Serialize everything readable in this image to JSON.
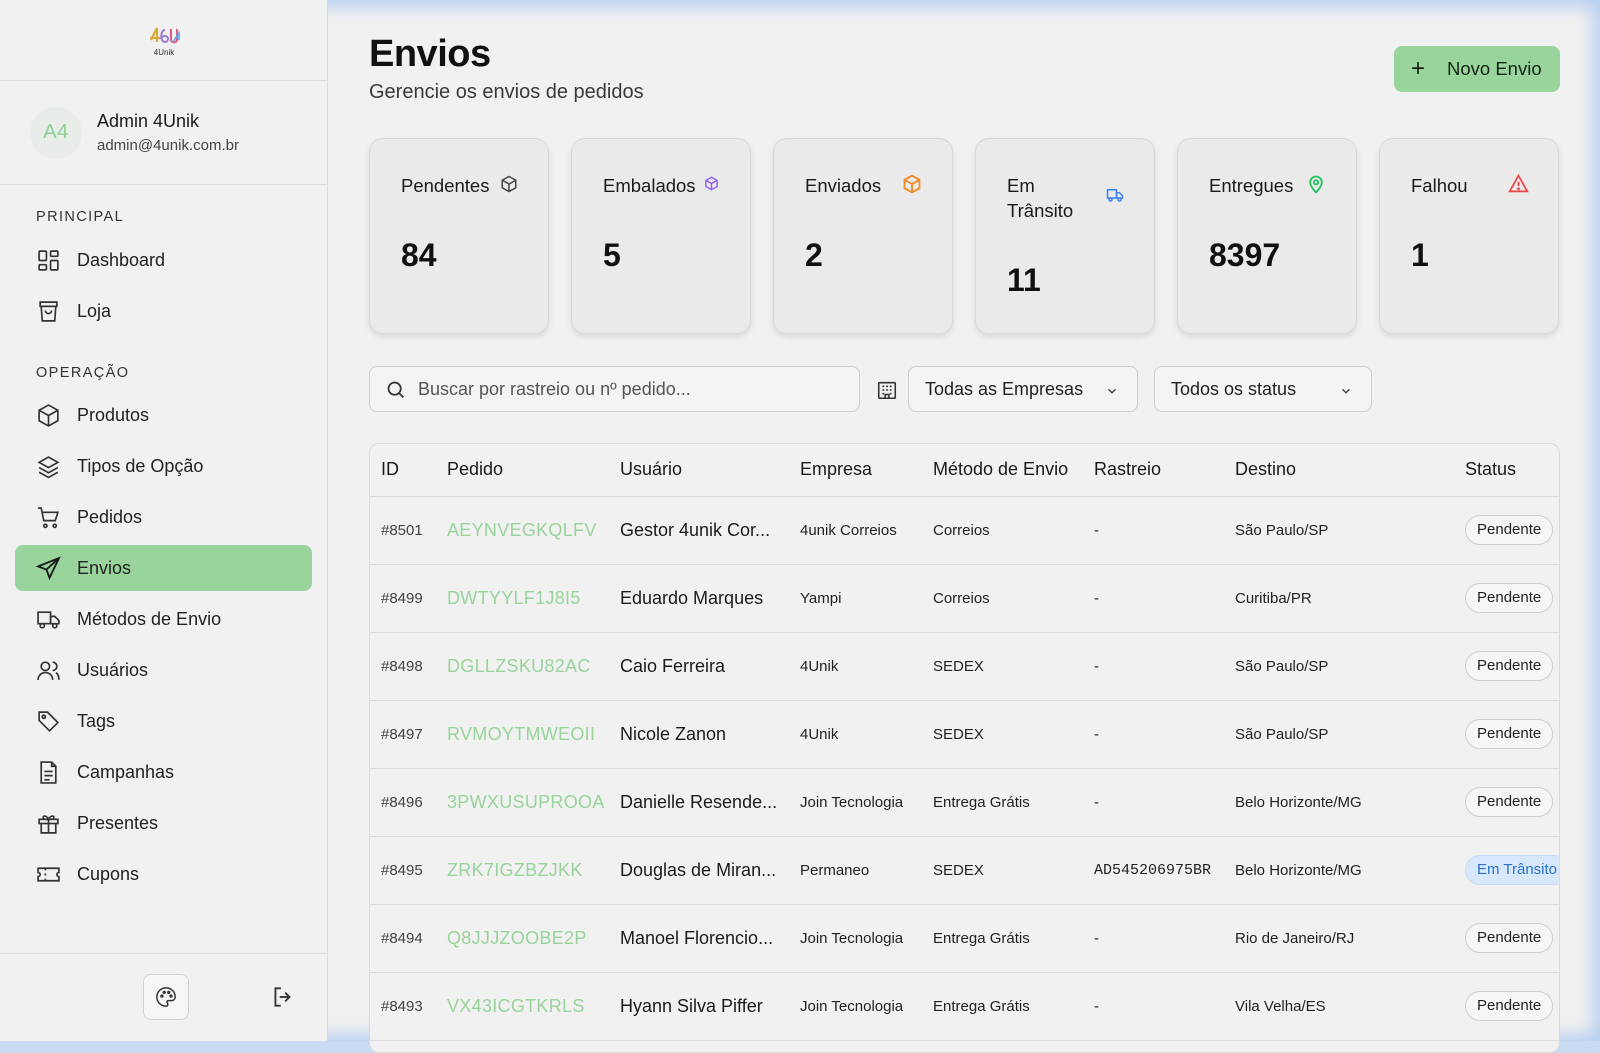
{
  "app": {
    "logo_text": "4Unik"
  },
  "user": {
    "initials": "A4",
    "name": "Admin 4Unik",
    "email": "admin@4unik.com.br"
  },
  "nav": {
    "sections": [
      {
        "title": "PRINCIPAL",
        "items": [
          {
            "label": "Dashboard",
            "icon": "dashboard-icon"
          },
          {
            "label": "Loja",
            "icon": "shopping-bag-icon"
          }
        ]
      },
      {
        "title": "OPERAÇÃO",
        "items": [
          {
            "label": "Produtos",
            "icon": "box-icon"
          },
          {
            "label": "Tipos de Opção",
            "icon": "layers-icon"
          },
          {
            "label": "Pedidos",
            "icon": "cart-icon"
          },
          {
            "label": "Envios",
            "icon": "send-icon",
            "active": true
          },
          {
            "label": "Métodos de Envio",
            "icon": "truck-icon"
          },
          {
            "label": "Usuários",
            "icon": "users-icon"
          },
          {
            "label": "Tags",
            "icon": "tag-icon"
          },
          {
            "label": "Campanhas",
            "icon": "document-icon"
          },
          {
            "label": "Presentes",
            "icon": "gift-icon"
          },
          {
            "label": "Cupons",
            "icon": "ticket-icon"
          }
        ]
      }
    ]
  },
  "page": {
    "title": "Envios",
    "subtitle": "Gerencie os envios de pedidos",
    "new_button": "Novo Envio"
  },
  "stats": [
    {
      "label": "Pendentes",
      "value": "84",
      "icon": "package-icon",
      "color": "#444444"
    },
    {
      "label": "Embalados",
      "value": "5",
      "icon": "package-icon",
      "color": "#8b5cf6"
    },
    {
      "label": "Enviados",
      "value": "2",
      "icon": "package-icon",
      "color": "#f08a24"
    },
    {
      "label": "Em Trânsito",
      "value": "11",
      "icon": "truck-icon",
      "color": "#3b82f6"
    },
    {
      "label": "Entregues",
      "value": "8397",
      "icon": "map-pin-icon",
      "color": "#22c55e"
    },
    {
      "label": "Falhou",
      "value": "1",
      "icon": "alert-triangle-icon",
      "color": "#ef4444"
    }
  ],
  "filters": {
    "search_placeholder": "Buscar por rastreio ou nº pedido...",
    "company_select": "Todas as Empresas",
    "status_select": "Todos os status"
  },
  "table": {
    "columns": [
      "ID",
      "Pedido",
      "Usuário",
      "Empresa",
      "Método de Envio",
      "Rastreio",
      "Destino",
      "Status"
    ],
    "rows": [
      {
        "id": "#8501",
        "pedido": "AEYNVEGKQLFV",
        "usuario": "Gestor 4unik Cor...",
        "empresa": "4unik Correios",
        "metodo": "Correios",
        "rastreio": "-",
        "destino": "São Paulo/SP",
        "status": "Pendente"
      },
      {
        "id": "#8499",
        "pedido": "DWTYYLF1J8I5",
        "usuario": "Eduardo Marques",
        "empresa": "Yampi",
        "metodo": "Correios",
        "rastreio": "-",
        "destino": "Curitiba/PR",
        "status": "Pendente"
      },
      {
        "id": "#8498",
        "pedido": "DGLLZSKU82AC",
        "usuario": "Caio Ferreira",
        "empresa": "4Unik",
        "metodo": "SEDEX",
        "rastreio": "-",
        "destino": "São Paulo/SP",
        "status": "Pendente"
      },
      {
        "id": "#8497",
        "pedido": "RVMOYTMWEOII",
        "usuario": "Nicole Zanon",
        "empresa": "4Unik",
        "metodo": "SEDEX",
        "rastreio": "-",
        "destino": "São Paulo/SP",
        "status": "Pendente"
      },
      {
        "id": "#8496",
        "pedido": "3PWXUSUPROOA",
        "usuario": "Danielle Resende...",
        "empresa": "Join Tecnologia",
        "metodo": "Entrega Grátis",
        "rastreio": "-",
        "destino": "Belo Horizonte/MG",
        "status": "Pendente"
      },
      {
        "id": "#8495",
        "pedido": "ZRK7IGZBZJKK",
        "usuario": "Douglas de Miran...",
        "empresa": "Permaneo",
        "metodo": "SEDEX",
        "rastreio": "AD545206975BR",
        "destino": "Belo Horizonte/MG",
        "status": "Em Trânsito"
      },
      {
        "id": "#8494",
        "pedido": "Q8JJJZOOBE2P",
        "usuario": "Manoel Florencio...",
        "empresa": "Join Tecnologia",
        "metodo": "Entrega Grátis",
        "rastreio": "-",
        "destino": "Rio de Janeiro/RJ",
        "status": "Pendente"
      },
      {
        "id": "#8493",
        "pedido": "VX43ICGTKRLS",
        "usuario": "Hyann Silva Piffer",
        "empresa": "Join Tecnologia",
        "metodo": "Entrega Grátis",
        "rastreio": "-",
        "destino": "Vila Velha/ES",
        "status": "Pendente"
      }
    ]
  },
  "footer": {
    "theme_icon": "palette-icon",
    "logout_icon": "logout-icon"
  }
}
